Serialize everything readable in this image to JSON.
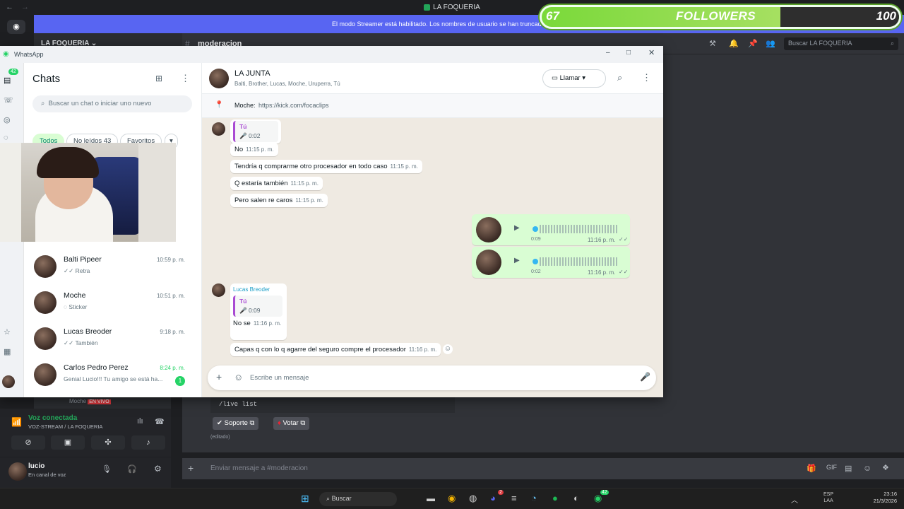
{
  "window_title": "LA FOQUERIA",
  "streamer_banner": "El modo Streamer está habilitado. Los nombres de usuario se han truncado",
  "followers": {
    "count": "67",
    "label": "FOLLOWERS",
    "goal": "100",
    "progress": 0.67
  },
  "discord": {
    "server_name": "LA FOQUERIA",
    "channel": "moderacion",
    "search_placeholder": "Buscar LA FOQUERIA",
    "notif_badge": "42",
    "command_text": "/live list",
    "btn_support": "Soporte",
    "btn_vote": "Votar",
    "edited": "(editado)",
    "input_placeholder": "Enviar mensaje a #moderacion",
    "voice_status": "Voz conectada",
    "voice_channel": "VOZ-STREAM / LA FOQUERIA",
    "user_name": "lucio",
    "user_status": "En canal de voz",
    "partial_row": "Moche",
    "partial_badge": "EN VIVO"
  },
  "whatsapp": {
    "app_title": "WhatsApp",
    "rail_badge": "42",
    "chats_title": "Chats",
    "search_placeholder": "Buscar un chat o iniciar uno nuevo",
    "filters": [
      {
        "label": "Todos",
        "active": true
      },
      {
        "label": "No leídos 43",
        "active": false
      },
      {
        "label": "Favoritos",
        "active": false
      }
    ],
    "chats": [
      {
        "name": "Balti Pipeer",
        "last": "✓✓ Retra",
        "time": "10:59 p. m.",
        "unread": ""
      },
      {
        "name": "Moche",
        "last": "◌ Sticker",
        "time": "10:51 p. m.",
        "unread": ""
      },
      {
        "name": "Lucas Breoder",
        "last": "✓✓ También",
        "time": "9:18 p. m.",
        "unread": ""
      },
      {
        "name": "Carlos Pedro Perez",
        "last": "Genial Lucio!!! Tu amigo se está ha...",
        "time": "8:24 p. m.",
        "unread": "1"
      }
    ],
    "conversation": {
      "name": "LA JUNTA",
      "members": "Balti, Brother, Lucas, Moche, Uruperra, Tú",
      "call_label": "Llamar",
      "pinned_author": "Moche:",
      "pinned_text": "https://kick.com/focaclips",
      "composer_placeholder": "Escribe un mensaje"
    },
    "messages": {
      "q1_name": "Tú",
      "q1_dur": "0:02",
      "m1": "No",
      "m1_t": "11:15 p. m.",
      "m2": "Tendría q comprarme otro procesador en todo caso",
      "m2_t": "11:15 p. m.",
      "m3": "Q estaría también",
      "m3_t": "11:15 p. m.",
      "m4": "Pero salen re caros",
      "m4_t": "11:15 p. m.",
      "a1_dur": "0:09",
      "a1_t": "11:16 p. m.",
      "a2_dur": "0:02",
      "a2_t": "11:16 p. m.",
      "sender": "Lucas Breoder",
      "q2_name": "Tú",
      "q2_dur": "0:09",
      "m5": "No se",
      "m5_t": "11:16 p. m.",
      "m6": "Capas q con lo q agarre del seguro compre el procesador",
      "m6_t": "11:16 p. m."
    }
  },
  "taskbar": {
    "search": "Buscar",
    "lang1": "ESP",
    "lang2": "LAA",
    "time": "23:16",
    "date": "21/3/2026",
    "discord_badge": "2",
    "wa_badge": "42"
  }
}
